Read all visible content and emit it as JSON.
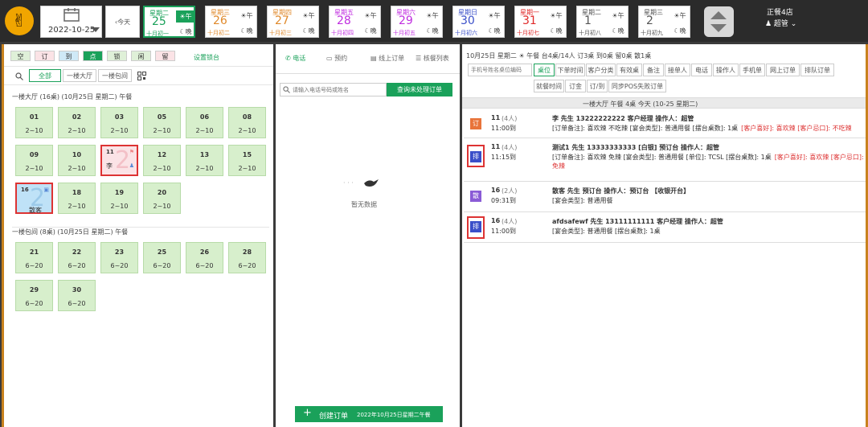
{
  "header": {
    "date": "2022-10-25",
    "today_label": "‹今天",
    "days": [
      {
        "weekday": "星期二",
        "day": "25",
        "lunar": "十月初一",
        "am": "☀午",
        "pm": "☾晚",
        "color": "#1aa15a",
        "selected": true
      },
      {
        "weekday": "星期三",
        "day": "26",
        "lunar": "十月初二",
        "am": "☀午",
        "pm": "☾晚",
        "color": "#e08a2c",
        "selected": false
      },
      {
        "weekday": "星期四",
        "day": "27",
        "lunar": "十月初三",
        "am": "☀午",
        "pm": "☾晚",
        "color": "#e08a2c",
        "selected": false
      },
      {
        "weekday": "星期五",
        "day": "28",
        "lunar": "十月初四",
        "am": "☀午",
        "pm": "☾晚",
        "color": "#c02ee0",
        "selected": false
      },
      {
        "weekday": "星期六",
        "day": "29",
        "lunar": "十月初五",
        "am": "☀午",
        "pm": "☾晚",
        "color": "#c02ee0",
        "selected": false
      },
      {
        "weekday": "星期日",
        "day": "30",
        "lunar": "十月初六",
        "am": "☀午",
        "pm": "☾晚",
        "color": "#3a4fc9",
        "selected": false
      },
      {
        "weekday": "星期一",
        "day": "31",
        "lunar": "十月初七",
        "am": "☀午",
        "pm": "☾晚",
        "color": "#e02a2a",
        "selected": false
      },
      {
        "weekday": "星期二",
        "day": "1",
        "lunar": "十月初八",
        "am": "☀午",
        "pm": "☾晚",
        "color": "#555555",
        "selected": false
      },
      {
        "weekday": "星期三",
        "day": "2",
        "lunar": "十月初九",
        "am": "☀午",
        "pm": "☾晚",
        "color": "#555555",
        "selected": false
      }
    ],
    "store": "正餐4店",
    "user": "♟ 超管 ⌄"
  },
  "left": {
    "status_buttons": [
      {
        "label": "空",
        "bg": "#dff0d8"
      },
      {
        "label": "订",
        "bg": "#fbe3e6"
      },
      {
        "label": "到",
        "bg": "#cfe9f7"
      },
      {
        "label": "点",
        "bg": "#1aa15a"
      },
      {
        "label": "锁",
        "bg": "#dff0d8"
      },
      {
        "label": "闲",
        "bg": "#dff0d8"
      },
      {
        "label": "留",
        "bg": "#fbe3e6"
      }
    ],
    "settings_link": "设置锁台",
    "filters": [
      "全部",
      "一楼大厅",
      "一楼包间"
    ],
    "sections": [
      {
        "title": "一楼大厅  (16桌)      (10月25日 星期二)    午餐"
      },
      {
        "title": "一楼包间  (8桌)      (10月25日 星期二)    午餐"
      }
    ],
    "hall_tables": [
      {
        "no": "01",
        "cap": "2~10"
      },
      {
        "no": "02",
        "cap": "2~10"
      },
      {
        "no": "03",
        "cap": "2~10"
      },
      {
        "no": "05",
        "cap": "2~10"
      },
      {
        "no": "06",
        "cap": "2~10"
      },
      {
        "no": "08",
        "cap": "2~10"
      },
      {
        "no": "09",
        "cap": "2~10"
      },
      {
        "no": "10",
        "cap": "2~10"
      },
      {
        "no": "11",
        "cap": "李",
        "state": "occ"
      },
      {
        "no": "12",
        "cap": "2~10"
      },
      {
        "no": "13",
        "cap": "2~10"
      },
      {
        "no": "15",
        "cap": "2~10"
      },
      {
        "no": "16",
        "cap": "散客",
        "state": "blu"
      },
      {
        "no": "18",
        "cap": "2~10"
      },
      {
        "no": "19",
        "cap": "2~10"
      },
      {
        "no": "20",
        "cap": "2~10"
      }
    ],
    "room_tables": [
      {
        "no": "21",
        "cap": "6~20"
      },
      {
        "no": "22",
        "cap": "6~20"
      },
      {
        "no": "23",
        "cap": "6~20"
      },
      {
        "no": "25",
        "cap": "6~20"
      },
      {
        "no": "26",
        "cap": "6~20"
      },
      {
        "no": "28",
        "cap": "6~20"
      },
      {
        "no": "29",
        "cap": "6~20"
      },
      {
        "no": "30",
        "cap": "6~20"
      }
    ]
  },
  "middle": {
    "tabs": [
      "电话",
      "预约",
      "线上订单",
      "核餐列表"
    ],
    "search_placeholder": "请输入电话号码或姓名",
    "query_button": "查询未处理订单",
    "empty_text": "暂无数据",
    "create_button": "创建订单",
    "create_sub": "2022年10月25日星期二午餐"
  },
  "right": {
    "summary": "10月25日  星期二  ☀ 午餐  台4桌/14人  订3桌  到0桌  留0桌  散1桌",
    "search_placeholder": "手机号姓名桌位编码",
    "tabs_row1": [
      "桌位",
      "下单时间",
      "客户分类",
      "有效桌",
      "备注",
      "接单人",
      "电话",
      "操作人",
      "手机单",
      "网上订单",
      "排队订单"
    ],
    "tabs_row2": [
      "就餐时间",
      "订金",
      "订/到",
      "同步POS失败订单"
    ],
    "group_header": "一楼大厅       午餐 4桌       今天 (10-25 星期二)",
    "orders": [
      {
        "badge": "订",
        "badge_color": "#e8743b",
        "table": "11",
        "people": "(4人)",
        "time": "11:00到",
        "line1": "李  先生   13222222222  客户经理  操作人：超管",
        "line2": "[订单备注]: 喜欢辣 不吃辣 [宴会类型]: 普通用餐 [摆台桌数]: 1桌",
        "line2_red": "[客户喜好]: 喜欢辣 [客户忌口]: 不吃辣"
      },
      {
        "badge": "排",
        "badge_color": "#3a4fc9",
        "table": "11",
        "people": "(4人)",
        "time": "11:15到",
        "line1": "测试1  先生   13333333333  [白银]  预订台  操作人：超管",
        "line2": "[订单备注]: 喜欢辣 免辣 [宴会类型]: 普通用餐 [单位]: TCSL [摆台桌数]: 1桌",
        "line2_red": "[客户喜好]: 喜欢辣 [客户忌口]: 免辣"
      },
      {
        "badge": "散",
        "badge_color": "#8a5bd6",
        "table": "16",
        "people": "(2人)",
        "time": "09:31到",
        "line1": "散客  先生   预订台  操作人：预订台   【收银开台】",
        "line2": "[宴会类型]: 普通用餐",
        "line2_red": ""
      },
      {
        "badge": "排",
        "badge_color": "#3a4fc9",
        "table": "16",
        "people": "(4人)",
        "time": "11:00到",
        "line1": "afdsafewf  先生   13111111111  客户经理  操作人：超管",
        "line2": "[宴会类型]: 普通用餐 [摆台桌数]: 1桌",
        "line2_red": ""
      }
    ]
  }
}
